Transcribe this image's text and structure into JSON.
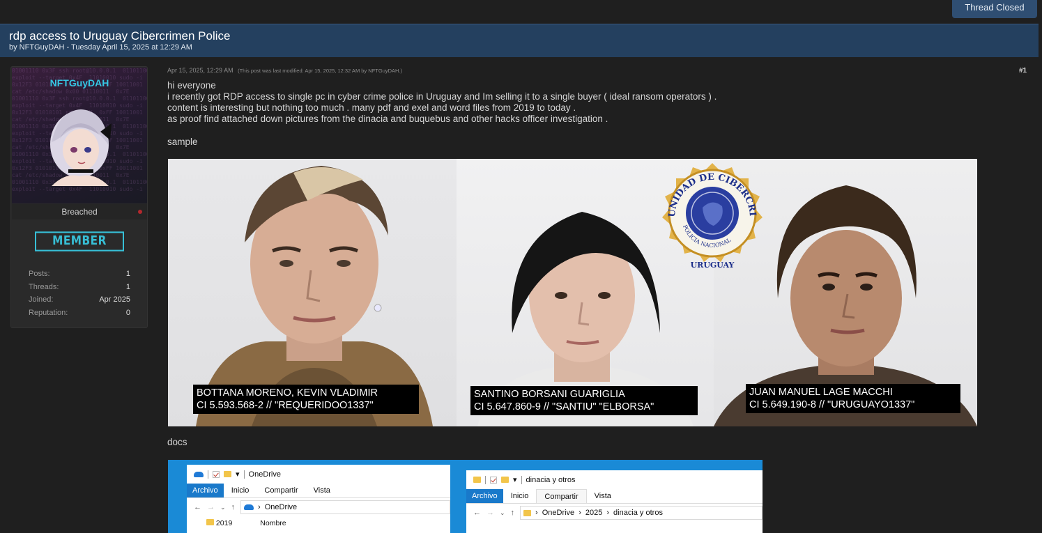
{
  "thread_status_button": "Thread Closed",
  "thread": {
    "title": "rdp access to Uruguay Cibercrimen Police",
    "byline": "by NFTGuyDAH - Tuesday April 15, 2025 at 12:29 AM"
  },
  "user": {
    "name": "NFTGuyDAH",
    "status": "Breached",
    "rank": "MEMBER",
    "stats": [
      {
        "label": "Posts:",
        "value": "1"
      },
      {
        "label": "Threads:",
        "value": "1"
      },
      {
        "label": "Joined:",
        "value": "Apr 2025"
      },
      {
        "label": "Reputation:",
        "value": "0"
      }
    ]
  },
  "post": {
    "date": "Apr 15, 2025, 12:29 AM",
    "edit_note": "(This post was last modified: Apr 15, 2025, 12:32 AM by NFTGuyDAH.)",
    "number": "#1",
    "lines": [
      "hi everyone",
      "i recently got RDP access to single pc in cyber crime police in Uruguay and Im selling it to a single buyer ( ideal ransom operators ) .",
      "content is interesting but nothing too much . many pdf and exel and word files from 2019 to today .",
      "as proof find attached down pictures from the dinacia and buquebus and other hacks officer investigation ."
    ],
    "sample_label": "sample",
    "docs_label": "docs"
  },
  "mugshots": [
    {
      "line1": "BOTTANA MORENO, KEVIN VLADIMIR",
      "line2": "CI 5.593.568-2 // \"REQUERIDOO1337\""
    },
    {
      "line1": "SANTINO BORSANI GUARIGLIA",
      "line2": "CI 5.647.860-9 // \"SANTIU\" \"ELBORSA\""
    },
    {
      "line1": "JUAN MANUEL LAGE MACCHI",
      "line2": "CI 5.649.190-8 // \"URUGUAYO1337\""
    }
  ],
  "seal": {
    "top_text": "UNIDAD DE CIBERCRIMEN",
    "bottom_text": "POLICIA NACIONAL",
    "country": "URUGUAY"
  },
  "explorer1": {
    "title": "OneDrive",
    "tabs": [
      "Archivo",
      "Inicio",
      "Compartir",
      "Vista"
    ],
    "path": [
      "OneDrive"
    ],
    "folder": "2019",
    "column": "Nombre"
  },
  "explorer2": {
    "title": "dinacia y otros",
    "tabs": [
      "Archivo",
      "Inicio",
      "Compartir",
      "Vista"
    ],
    "path": [
      "OneDrive",
      "2025",
      "dinacia y otros"
    ]
  },
  "colors": {
    "page_bg": "#1f1f1f",
    "header_bg": "#24405f",
    "accent_cyan": "#35c6e3",
    "status_dot": "#b3282d"
  }
}
